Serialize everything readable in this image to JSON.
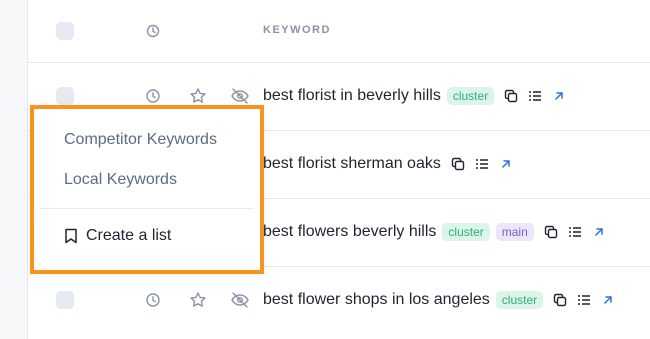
{
  "table": {
    "header": {
      "keyword_label": "KEYWORD"
    },
    "rows": [
      {
        "keyword": "best florist in beverly hills",
        "tags": [
          "cluster"
        ]
      },
      {
        "keyword": "best florist sherman oaks",
        "tags": []
      },
      {
        "keyword": "best flowers beverly hills",
        "tags": [
          "cluster",
          "main"
        ]
      },
      {
        "keyword": "best flower shops in los angeles",
        "tags": [
          "cluster"
        ]
      }
    ]
  },
  "dropdown": {
    "items": [
      "Competitor Keywords",
      "Local Keywords"
    ],
    "create_label": "Create a list",
    "highlight_color": "#f7931e"
  },
  "icons": [
    "clock-icon",
    "star-icon",
    "eye-off-icon",
    "copy-icon",
    "list-icon",
    "external-link-icon",
    "bookmark-icon"
  ]
}
